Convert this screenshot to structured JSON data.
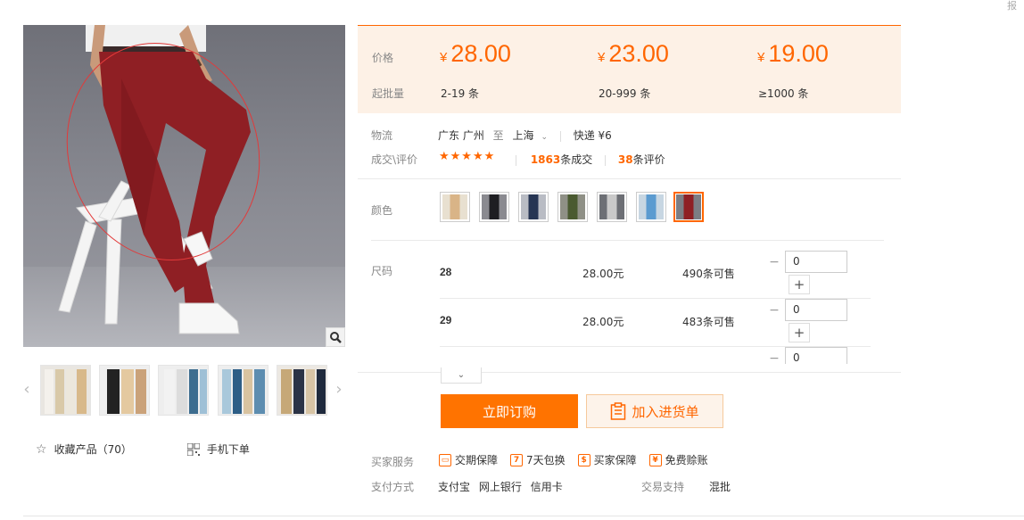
{
  "product": {
    "favorite_label": "收藏产品（70）",
    "mobile_order_label": "手机下单"
  },
  "price_box": {
    "price_label": "价格",
    "min_label": "起批量",
    "currency": "¥",
    "tiers": [
      {
        "price": "28.00",
        "qty": "2-19 条"
      },
      {
        "price": "23.00",
        "qty": "20-999 条"
      },
      {
        "price": "19.00",
        "qty": "≥1000 条"
      }
    ]
  },
  "logistics": {
    "label": "物流",
    "origin": "广东 广州",
    "to_word": "至",
    "destination": "上海",
    "shipping": "快递 ¥6"
  },
  "trade": {
    "label": "成交\\评价",
    "stars": "★★★★★",
    "deals_count": "1863",
    "deals_suffix": "条成交",
    "reviews_count": "38",
    "reviews_suffix": "条评价"
  },
  "color": {
    "label": "颜色",
    "selected_index": 6
  },
  "sizes": {
    "label": "尺码",
    "rows": [
      {
        "size": "28",
        "price": "28.00元",
        "stock": "490条可售",
        "qty": "0"
      },
      {
        "size": "29",
        "price": "28.00元",
        "stock": "483条可售",
        "qty": "0"
      },
      {
        "qty": "0"
      }
    ]
  },
  "actions": {
    "order_now": "立即订购",
    "add_cart": "加入进货单"
  },
  "services": {
    "label": "买家服务",
    "items": [
      "交期保障",
      "7天包换",
      "买家保障",
      "免费赊账"
    ]
  },
  "payment": {
    "label": "支付方式",
    "methods": [
      "支付宝",
      "网上银行",
      "信用卡"
    ],
    "support_label": "交易支持",
    "support_value": "混批"
  },
  "top_right_fragment": "报",
  "colors": {
    "accent": "#ff6600",
    "order_button": "#ff7300",
    "price_bg": "#fdf1e6"
  }
}
